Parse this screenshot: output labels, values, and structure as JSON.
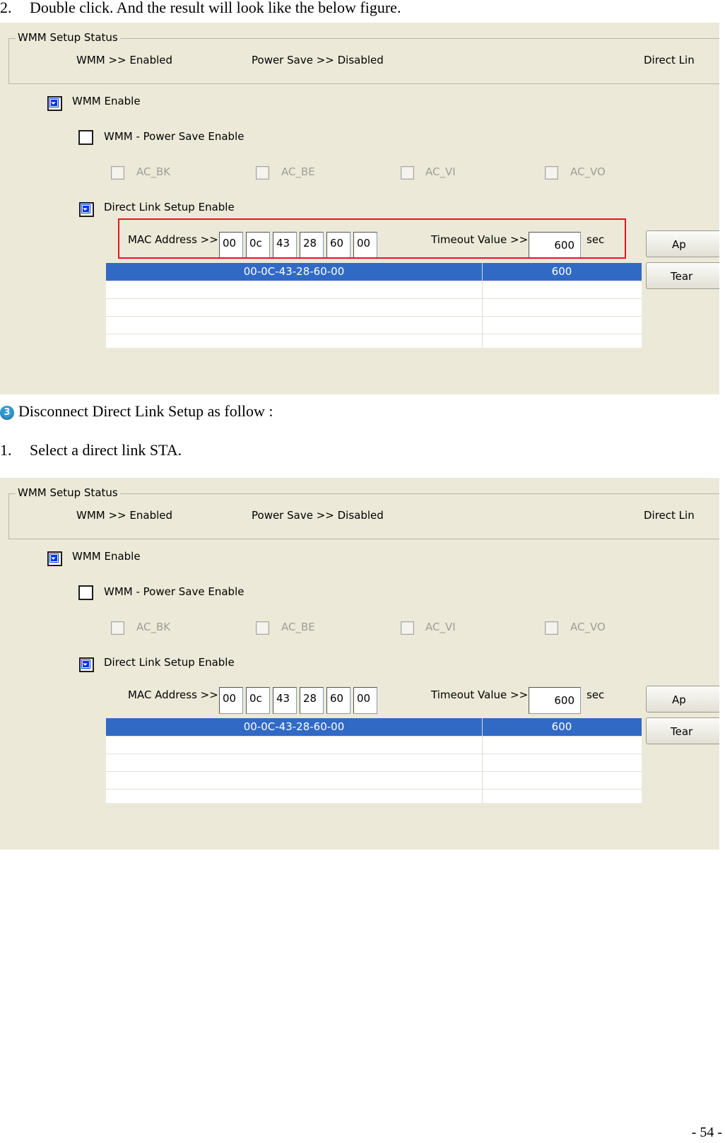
{
  "doc": {
    "step_double_click_num": "2.",
    "step_double_click_text": "Double click. And the result will look like the below figure.",
    "section_badge": "3",
    "section_title": "Disconnect Direct Link Setup as follow :",
    "step_select_num": "1.",
    "step_select_text": "Select a direct link STA.",
    "page_number": "- 54 -"
  },
  "screenshot": {
    "group_title": "WMM Setup Status",
    "wmm_status": "WMM >> Enabled",
    "power_save_status": "Power Save >> Disabled",
    "direct_link_status": "Direct Lin",
    "wmm_enable_label": "WMM Enable",
    "wmm_power_save_label": "WMM - Power Save Enable",
    "ac_bk": "AC_BK",
    "ac_be": "AC_BE",
    "ac_vi": "AC_VI",
    "ac_vo": "AC_VO",
    "dls_enable_label": "Direct Link Setup Enable",
    "mac_label": "MAC Address >>",
    "mac": [
      "00",
      "0c",
      "43",
      "28",
      "60",
      "00"
    ],
    "timeout_label": "Timeout Value >>",
    "timeout_value": "600",
    "sec_label": "sec",
    "apply_button": "Ap",
    "teardown_button": "Tear",
    "row_mac": "00-0C-43-28-60-00",
    "row_timeout": "600",
    "checked": {
      "wmm_enable": true,
      "power_save_enable": false,
      "dls_enable": true
    }
  },
  "colors": {
    "highlight": "#e8141c",
    "selection": "#316ac5",
    "panel": "#ece9d8"
  }
}
